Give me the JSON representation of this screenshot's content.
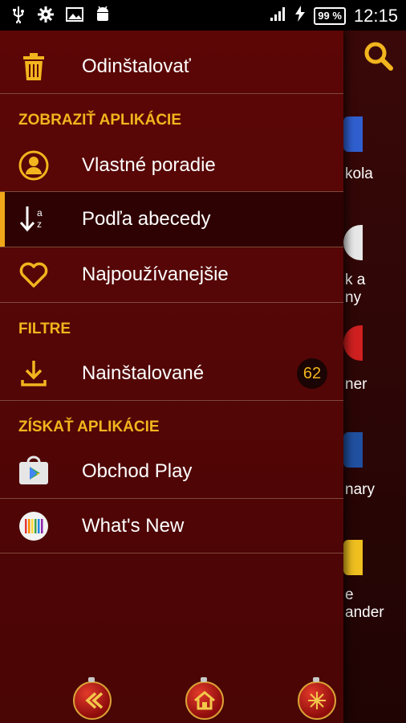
{
  "status_bar": {
    "battery": "99 %",
    "time": "12:15"
  },
  "drawer": {
    "uninstall_label": "Odinštalovať",
    "sections": {
      "show_apps": "ZOBRAZIŤ APLIKÁCIE",
      "filters": "FILTRE",
      "get_apps": "ZÍSKAŤ APLIKÁCIE"
    },
    "sort_items": [
      {
        "label": "Vlastné poradie",
        "icon": "user-circle-icon"
      },
      {
        "label": "Podľa abecedy",
        "icon": "sort-alpha-icon",
        "selected": true
      },
      {
        "label": "Najpoužívanejšie",
        "icon": "heart-icon"
      }
    ],
    "filter_items": [
      {
        "label": "Nainštalované",
        "icon": "download-icon",
        "badge": "62"
      }
    ],
    "store_items": [
      {
        "label": "Obchod Play",
        "icon": "play-store-icon"
      },
      {
        "label": "What's New",
        "icon": "whats-new-icon"
      }
    ]
  },
  "background_labels": [
    "kola",
    "k a",
    "ny",
    "ner",
    "nary",
    "e",
    "ander"
  ],
  "colors": {
    "accent": "#f2b51e",
    "drawer_bg": "#5c0606",
    "selected_bg": "#2e0202"
  }
}
